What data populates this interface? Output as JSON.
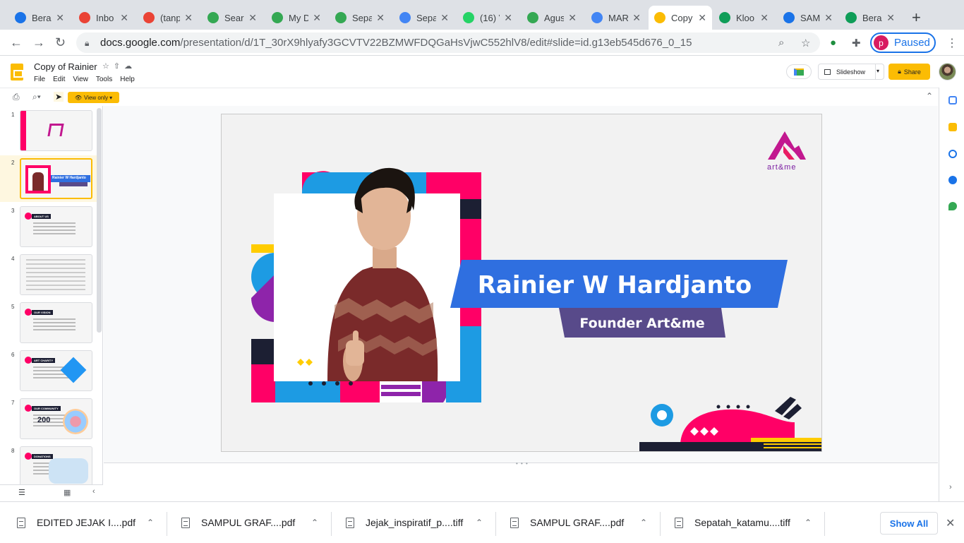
{
  "browser": {
    "tabs": [
      {
        "label": "Bera",
        "icon": "c-icon",
        "color": "#1a73e8"
      },
      {
        "label": "Inbo",
        "icon": "gmail-icon",
        "color": "#ea4335"
      },
      {
        "label": "(tanp",
        "icon": "gmail-icon",
        "color": "#ea4335"
      },
      {
        "label": "Sear",
        "icon": "drive-icon",
        "color": "#34a853"
      },
      {
        "label": "My D",
        "icon": "drive-icon",
        "color": "#34a853"
      },
      {
        "label": "Sepa",
        "icon": "drive-icon",
        "color": "#34a853"
      },
      {
        "label": "Sepa",
        "icon": "docs-icon",
        "color": "#4285f4"
      },
      {
        "label": "(16) V",
        "icon": "wa-icon",
        "color": "#25d366"
      },
      {
        "label": "Agus",
        "icon": "drive-icon",
        "color": "#34a853"
      },
      {
        "label": "MAR",
        "icon": "docs-icon",
        "color": "#4285f4"
      },
      {
        "label": "Copy",
        "icon": "slides-icon",
        "color": "#fbbc04"
      },
      {
        "label": "Kloo",
        "icon": "sheets-icon",
        "color": "#0f9d58"
      },
      {
        "label": "SAM",
        "icon": "c-icon",
        "color": "#1a73e8"
      },
      {
        "label": "Bera",
        "icon": "star-icon",
        "color": "#0f9d58"
      }
    ],
    "url_host": "docs.google.com",
    "url_path": "/presentation/d/1T_30rX9hlyafy3GCVTV22BZMWFDQGaHsVjwC552hlV8/edit#slide=id.g13eb545d676_0_15",
    "profile_initial": "p",
    "profile_label": "Paused"
  },
  "doc": {
    "title": "Copy of Rainier",
    "menu": [
      "File",
      "Edit",
      "View",
      "Tools",
      "Help"
    ],
    "slideshow_label": "Slideshow",
    "share_label": "Share",
    "view_only_label": "View only"
  },
  "filmstrip": {
    "slides": [
      {
        "num": "1",
        "text": ""
      },
      {
        "num": "2",
        "text": "Rainier W Hardjanto"
      },
      {
        "num": "3",
        "text": "ABOUT US"
      },
      {
        "num": "4",
        "text": ""
      },
      {
        "num": "5",
        "text": "OUR VISION"
      },
      {
        "num": "6",
        "text": "ART CHARITY"
      },
      {
        "num": "7",
        "text": "OUR COMMUNITY"
      },
      {
        "num": "8",
        "text": "DONATIONS"
      }
    ],
    "slide7_number": "200"
  },
  "slide": {
    "name": "Rainier W Hardjanto",
    "role": "Founder Art&me",
    "logo_text": "art&me"
  },
  "downloads": [
    {
      "name": "EDITED JEJAK I....pdf"
    },
    {
      "name": "SAMPUL GRAF....pdf"
    },
    {
      "name": "Jejak_inspiratif_p....tiff"
    },
    {
      "name": "SAMPUL GRAF....pdf"
    },
    {
      "name": "Sepatah_katamu....tiff"
    }
  ],
  "show_all_label": "Show All"
}
